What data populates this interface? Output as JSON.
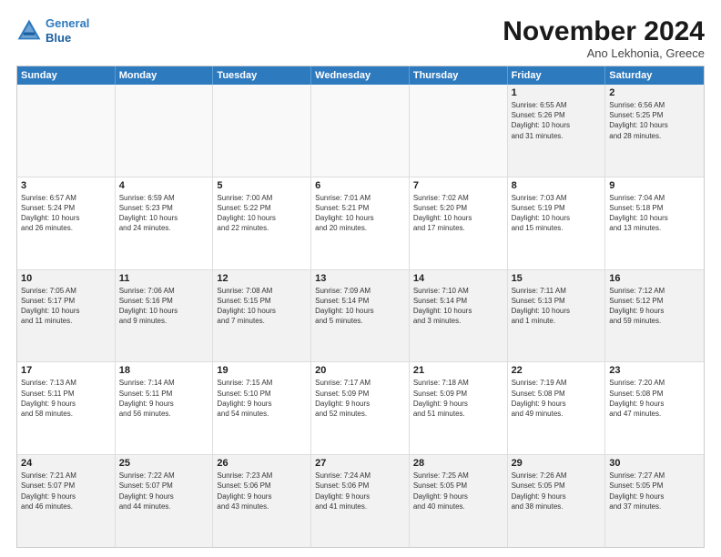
{
  "header": {
    "logo_line1": "General",
    "logo_line2": "Blue",
    "month": "November 2024",
    "location": "Ano Lekhonia, Greece"
  },
  "weekdays": [
    "Sunday",
    "Monday",
    "Tuesday",
    "Wednesday",
    "Thursday",
    "Friday",
    "Saturday"
  ],
  "weeks": [
    [
      {
        "day": "",
        "info": "",
        "empty": true
      },
      {
        "day": "",
        "info": "",
        "empty": true
      },
      {
        "day": "",
        "info": "",
        "empty": true
      },
      {
        "day": "",
        "info": "",
        "empty": true
      },
      {
        "day": "",
        "info": "",
        "empty": true
      },
      {
        "day": "1",
        "info": "Sunrise: 6:55 AM\nSunset: 5:26 PM\nDaylight: 10 hours\nand 31 minutes.",
        "empty": false
      },
      {
        "day": "2",
        "info": "Sunrise: 6:56 AM\nSunset: 5:25 PM\nDaylight: 10 hours\nand 28 minutes.",
        "empty": false
      }
    ],
    [
      {
        "day": "3",
        "info": "Sunrise: 6:57 AM\nSunset: 5:24 PM\nDaylight: 10 hours\nand 26 minutes.",
        "empty": false
      },
      {
        "day": "4",
        "info": "Sunrise: 6:59 AM\nSunset: 5:23 PM\nDaylight: 10 hours\nand 24 minutes.",
        "empty": false
      },
      {
        "day": "5",
        "info": "Sunrise: 7:00 AM\nSunset: 5:22 PM\nDaylight: 10 hours\nand 22 minutes.",
        "empty": false
      },
      {
        "day": "6",
        "info": "Sunrise: 7:01 AM\nSunset: 5:21 PM\nDaylight: 10 hours\nand 20 minutes.",
        "empty": false
      },
      {
        "day": "7",
        "info": "Sunrise: 7:02 AM\nSunset: 5:20 PM\nDaylight: 10 hours\nand 17 minutes.",
        "empty": false
      },
      {
        "day": "8",
        "info": "Sunrise: 7:03 AM\nSunset: 5:19 PM\nDaylight: 10 hours\nand 15 minutes.",
        "empty": false
      },
      {
        "day": "9",
        "info": "Sunrise: 7:04 AM\nSunset: 5:18 PM\nDaylight: 10 hours\nand 13 minutes.",
        "empty": false
      }
    ],
    [
      {
        "day": "10",
        "info": "Sunrise: 7:05 AM\nSunset: 5:17 PM\nDaylight: 10 hours\nand 11 minutes.",
        "empty": false
      },
      {
        "day": "11",
        "info": "Sunrise: 7:06 AM\nSunset: 5:16 PM\nDaylight: 10 hours\nand 9 minutes.",
        "empty": false
      },
      {
        "day": "12",
        "info": "Sunrise: 7:08 AM\nSunset: 5:15 PM\nDaylight: 10 hours\nand 7 minutes.",
        "empty": false
      },
      {
        "day": "13",
        "info": "Sunrise: 7:09 AM\nSunset: 5:14 PM\nDaylight: 10 hours\nand 5 minutes.",
        "empty": false
      },
      {
        "day": "14",
        "info": "Sunrise: 7:10 AM\nSunset: 5:14 PM\nDaylight: 10 hours\nand 3 minutes.",
        "empty": false
      },
      {
        "day": "15",
        "info": "Sunrise: 7:11 AM\nSunset: 5:13 PM\nDaylight: 10 hours\nand 1 minute.",
        "empty": false
      },
      {
        "day": "16",
        "info": "Sunrise: 7:12 AM\nSunset: 5:12 PM\nDaylight: 9 hours\nand 59 minutes.",
        "empty": false
      }
    ],
    [
      {
        "day": "17",
        "info": "Sunrise: 7:13 AM\nSunset: 5:11 PM\nDaylight: 9 hours\nand 58 minutes.",
        "empty": false
      },
      {
        "day": "18",
        "info": "Sunrise: 7:14 AM\nSunset: 5:11 PM\nDaylight: 9 hours\nand 56 minutes.",
        "empty": false
      },
      {
        "day": "19",
        "info": "Sunrise: 7:15 AM\nSunset: 5:10 PM\nDaylight: 9 hours\nand 54 minutes.",
        "empty": false
      },
      {
        "day": "20",
        "info": "Sunrise: 7:17 AM\nSunset: 5:09 PM\nDaylight: 9 hours\nand 52 minutes.",
        "empty": false
      },
      {
        "day": "21",
        "info": "Sunrise: 7:18 AM\nSunset: 5:09 PM\nDaylight: 9 hours\nand 51 minutes.",
        "empty": false
      },
      {
        "day": "22",
        "info": "Sunrise: 7:19 AM\nSunset: 5:08 PM\nDaylight: 9 hours\nand 49 minutes.",
        "empty": false
      },
      {
        "day": "23",
        "info": "Sunrise: 7:20 AM\nSunset: 5:08 PM\nDaylight: 9 hours\nand 47 minutes.",
        "empty": false
      }
    ],
    [
      {
        "day": "24",
        "info": "Sunrise: 7:21 AM\nSunset: 5:07 PM\nDaylight: 9 hours\nand 46 minutes.",
        "empty": false
      },
      {
        "day": "25",
        "info": "Sunrise: 7:22 AM\nSunset: 5:07 PM\nDaylight: 9 hours\nand 44 minutes.",
        "empty": false
      },
      {
        "day": "26",
        "info": "Sunrise: 7:23 AM\nSunset: 5:06 PM\nDaylight: 9 hours\nand 43 minutes.",
        "empty": false
      },
      {
        "day": "27",
        "info": "Sunrise: 7:24 AM\nSunset: 5:06 PM\nDaylight: 9 hours\nand 41 minutes.",
        "empty": false
      },
      {
        "day": "28",
        "info": "Sunrise: 7:25 AM\nSunset: 5:05 PM\nDaylight: 9 hours\nand 40 minutes.",
        "empty": false
      },
      {
        "day": "29",
        "info": "Sunrise: 7:26 AM\nSunset: 5:05 PM\nDaylight: 9 hours\nand 38 minutes.",
        "empty": false
      },
      {
        "day": "30",
        "info": "Sunrise: 7:27 AM\nSunset: 5:05 PM\nDaylight: 9 hours\nand 37 minutes.",
        "empty": false
      }
    ]
  ]
}
